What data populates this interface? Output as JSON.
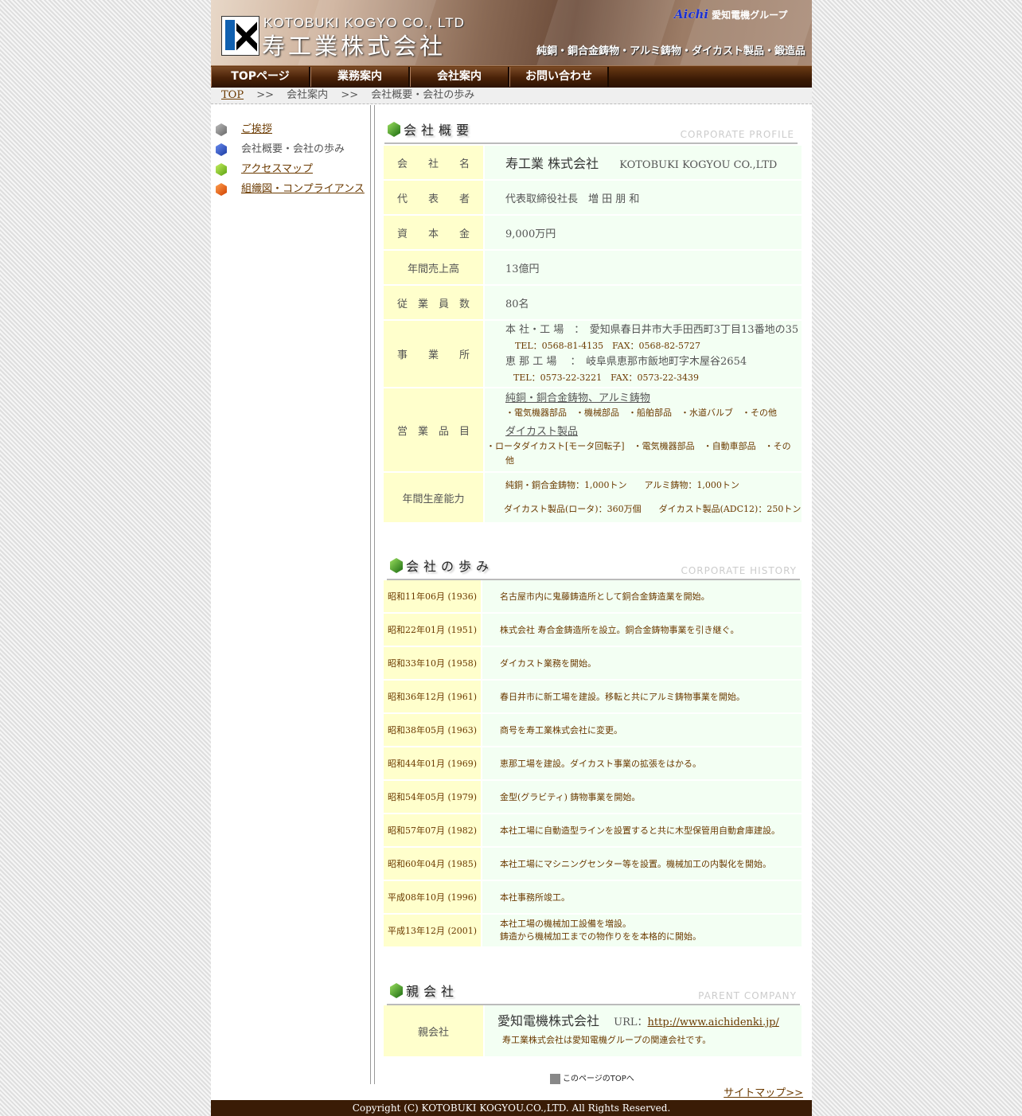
{
  "header": {
    "company_en": "KOTOBUKI KOGYO CO., LTD",
    "company_jp": "寿工業株式会社",
    "group_brand": "Aichi",
    "group_name": "愛知電機グループ",
    "tagline": "純銅・銅合金鋳物・アルミ鋳物・ダイカスト製品・鍛造品"
  },
  "nav": [
    "TOPページ",
    "業務案内",
    "会社案内",
    "お問い合わせ"
  ],
  "breadcrumb": {
    "top": "TOP",
    "sep": ">>",
    "section": "会社案内",
    "current": "会社概要・会社の歩み"
  },
  "sidebar": {
    "items": [
      {
        "label": "ご挨拶",
        "icon": "gray-cube-icon"
      },
      {
        "label": "会社概要・会社の歩み",
        "icon": "blue-cube-icon"
      },
      {
        "label": "アクセスマップ",
        "icon": "green-cube-icon"
      },
      {
        "label": "組織図・コンプライアンス",
        "icon": "orange-cube-icon"
      }
    ]
  },
  "profile": {
    "title": "会社概要",
    "title_en": "CORPORATE PROFILE",
    "company_label": "会　　社　　名",
    "company_name": "寿工業 株式会社",
    "company_name_en": "KOTOBUKI KOGYOU CO.,LTD",
    "rep_label": "代　　表　　者",
    "rep_value": "代表取締役社長　増 田 朋 和",
    "capital_label": "資　　本　　金",
    "capital_value": "9,000万円",
    "sales_label": "年間売上高",
    "sales_value": "13億円",
    "employees_label": "従　業　員　数",
    "employees_value": "80名",
    "offices_label": "事　　業　　所",
    "office1": "本 社・工 場　：　愛知県春日井市大手田西町3丁目13番地の35",
    "office1_tel": "TEL：0568-81-4135　FAX：0568-82-5727",
    "office2": "恵 那 工 場　 ：　岐阜県恵那市飯地町字木屋谷2654",
    "office2_tel": "TEL：0573-22-3221　FAX：0573-22-3439",
    "products_label": "営　業　品　目",
    "products_cat1": "純銅・銅合金鋳物、アルミ鋳物",
    "products_cat1_items": "・電気機器部品　・機械部品　・船舶部品　・水道バルブ　・その他",
    "products_cat2": "ダイカスト製品",
    "products_cat2_items": "・ロータダイカスト[モータ回転子]　・電気機器部品　・自動車部品　・その他",
    "capacity_label": "年間生産能力",
    "capacity_line1": "純銅・銅合金鋳物：1,000トン　　アルミ鋳物：1,000トン",
    "capacity_line2": "ダイカスト製品(ロータ)：360万個　　ダイカスト製品(ADC12)：250トン"
  },
  "history": {
    "title": "会社の歩み",
    "title_en": "CORPORATE HISTORY",
    "rows": [
      {
        "date": "昭和11年06月 (1936)",
        "text": "名古屋市内に鬼藤鋳造所として銅合金鋳造業を開始。"
      },
      {
        "date": "昭和22年01月 (1951)",
        "text": "株式会社 寿合金鋳造所を設立。銅合金鋳物事業を引き継ぐ。"
      },
      {
        "date": "昭和33年10月 (1958)",
        "text": "ダイカスト業務を開始。"
      },
      {
        "date": "昭和36年12月 (1961)",
        "text": "春日井市に新工場を建設。移転と共にアルミ鋳物事業を開始。"
      },
      {
        "date": "昭和38年05月 (1963)",
        "text": "商号を寿工業株式会社に変更。"
      },
      {
        "date": "昭和44年01月 (1969)",
        "text": "恵那工場を建設。ダイカスト事業の拡張をはかる。"
      },
      {
        "date": "昭和54年05月 (1979)",
        "text": "金型(グラビティ) 鋳物事業を開始。"
      },
      {
        "date": "昭和57年07月 (1982)",
        "text": "本社工場に自動造型ラインを設置すると共に木型保管用自動倉庫建設。"
      },
      {
        "date": "昭和60年04月 (1985)",
        "text": "本社工場にマシニングセンター等を設置。機械加工の内製化を開始。"
      },
      {
        "date": "平成08年10月 (1996)",
        "text": "本社事務所竣工。"
      },
      {
        "date": "平成13年12月 (2001)",
        "text": "本社工場の機械加工設備を増設。",
        "text2": "鋳造から機械加工までの物作りをを本格的に開始。"
      }
    ]
  },
  "parent": {
    "title": "親会社",
    "title_en": "PARENT COMPANY",
    "label": "親会社",
    "name": "愛知電機株式会社",
    "url_label": "URL：",
    "url": "http://www.aichidenki.jp/",
    "note": "寿工業株式会社は愛知電機グループの関連会社です。"
  },
  "page_top_label": "このページのTOPへ",
  "sitemap_label": "サイトマップ>>",
  "footer": "Copyright (C) KOTOBUKI KOGYOU.CO.,LTD. All Rights Reserved."
}
